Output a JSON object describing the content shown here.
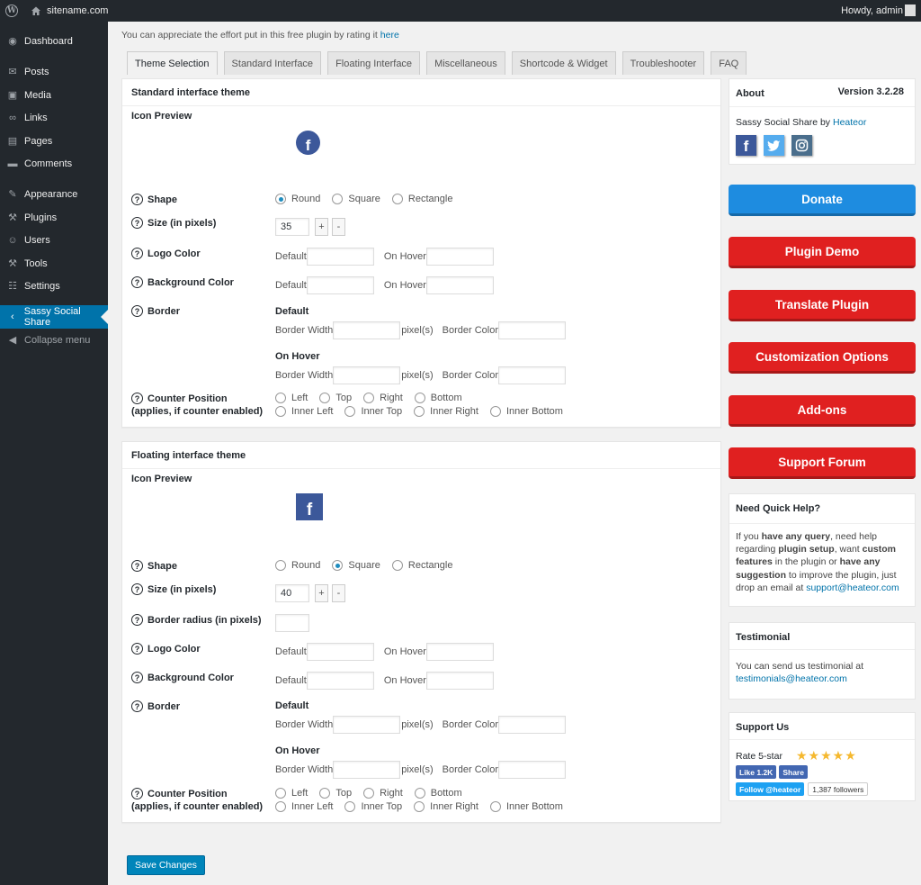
{
  "adminbar": {
    "site": "sitename.com",
    "howdy": "Howdy, admin"
  },
  "menu": [
    {
      "label": "Dashboard",
      "icon": "dashboard-icon"
    },
    {
      "label": "Posts",
      "icon": "pin-icon"
    },
    {
      "label": "Media",
      "icon": "media-icon"
    },
    {
      "label": "Links",
      "icon": "link-icon"
    },
    {
      "label": "Pages",
      "icon": "page-icon"
    },
    {
      "label": "Comments",
      "icon": "comment-icon"
    },
    {
      "label": "Appearance",
      "icon": "brush-icon"
    },
    {
      "label": "Plugins",
      "icon": "plugin-icon"
    },
    {
      "label": "Users",
      "icon": "user-icon"
    },
    {
      "label": "Tools",
      "icon": "wrench-icon"
    },
    {
      "label": "Settings",
      "icon": "settings-icon"
    },
    {
      "label": "Sassy Social Share",
      "icon": "share-icon"
    },
    {
      "label": "Collapse menu",
      "icon": "collapse-icon"
    }
  ],
  "rate": {
    "text": "You can appreciate the effort put in this free plugin by rating it ",
    "link": "here"
  },
  "tabs": [
    "Theme Selection",
    "Standard Interface",
    "Floating Interface",
    "Miscellaneous",
    "Shortcode & Widget",
    "Troubleshooter",
    "FAQ"
  ],
  "labels": {
    "shape": "Shape",
    "size": "Size (in pixels)",
    "logo_color": "Logo Color",
    "bg_color": "Background Color",
    "border": "Border",
    "counter": "Counter Position",
    "counter_sub": "(applies, if counter enabled)",
    "border_radius": "Border radius (in pixels)",
    "icon_preview": "Icon Preview",
    "default": "Default",
    "on_hover": "On Hover",
    "border_width": "Border Width",
    "pixels": "pixel(s)",
    "border_color": "Border Color",
    "plus": "+",
    "minus": "-"
  },
  "shapes": [
    "Round",
    "Square",
    "Rectangle"
  ],
  "counter_positions_1": [
    "Left",
    "Top",
    "Right",
    "Bottom"
  ],
  "counter_positions_2": [
    "Inner Left",
    "Inner Top",
    "Inner Right",
    "Inner Bottom"
  ],
  "standard": {
    "title": "Standard interface theme",
    "size": "35",
    "shape": "Round"
  },
  "floating": {
    "title": "Floating interface theme",
    "size": "40",
    "shape": "Square"
  },
  "about": {
    "title": "About",
    "version": "Version 3.2.28",
    "plugin": "Sassy Social Share",
    "by": " by ",
    "author": "Heateor"
  },
  "buttons": [
    "Donate",
    "Plugin Demo",
    "Translate Plugin",
    "Customization Options",
    "Add-ons",
    "Support Forum"
  ],
  "help": {
    "title": "Need Quick Help?",
    "t1": "If you ",
    "b1": "have any query",
    "t2": ", need help regarding ",
    "b2": "plugin setup",
    "t3": ", want ",
    "b3": "custom features",
    "t4": " in the plugin or ",
    "b4": "have any suggestion",
    "t5": " to improve the plugin, just drop an email at ",
    "email": "support@heateor.com"
  },
  "testimonial": {
    "title": "Testimonial",
    "text": "You can send us testimonial at",
    "email": "testimonials@heateor.com"
  },
  "support": {
    "title": "Support Us",
    "rate": "Rate 5-star",
    "like": "Like 1.2K",
    "share": "Share",
    "follow": "Follow @heateor",
    "followers": "1,387 followers",
    "stars": 5
  },
  "save": "Save Changes"
}
